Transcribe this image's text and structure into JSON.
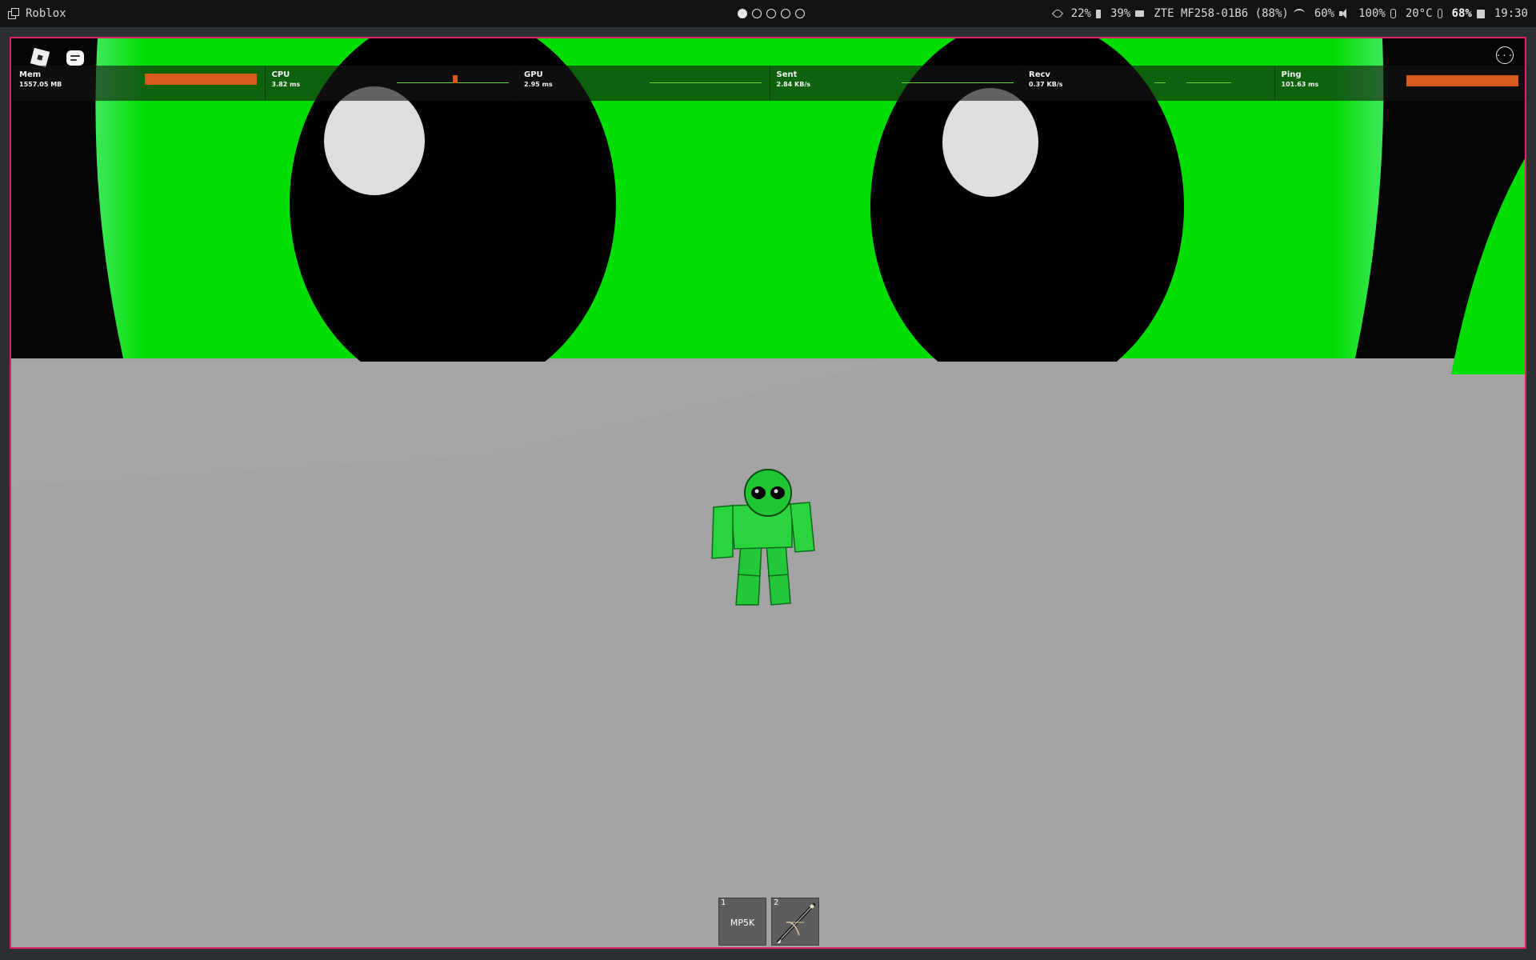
{
  "system_bar": {
    "app_title": "Roblox",
    "workspaces": [
      true,
      false,
      false,
      false,
      false
    ],
    "tray": {
      "cpu": "22%",
      "memory": "39%",
      "network_name": "ZTE MF258-01B6 (88%)",
      "brightness": "60%",
      "volume": "100%",
      "temperature": "20°C",
      "battery": "68%",
      "clock": "19:30"
    }
  },
  "game": {
    "colors": {
      "window_border": "#e0226b",
      "floor": "#a3a3a3",
      "backdrop": "#00dd00"
    },
    "perf": [
      {
        "label": "Mem",
        "value": "1557.05 MB",
        "graph": "bar"
      },
      {
        "label": "CPU",
        "value": "3.82 ms",
        "graph": "spike"
      },
      {
        "label": "GPU",
        "value": "2.95 ms",
        "graph": "line"
      },
      {
        "label": "Sent",
        "value": "2.84 KB/s",
        "graph": "line"
      },
      {
        "label": "Recv",
        "value": "0.37 KB/s",
        "graph": "line"
      },
      {
        "label": "Ping",
        "value": "101.63 ms",
        "graph": "bar"
      }
    ],
    "more_label": "···",
    "hotbar": [
      {
        "number": "1",
        "label": "MP5K",
        "icon": ""
      },
      {
        "number": "2",
        "label": "",
        "icon": "crossbow-icon"
      }
    ]
  }
}
